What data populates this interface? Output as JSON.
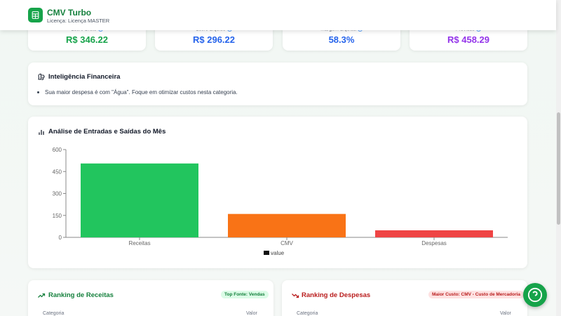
{
  "header": {
    "title": "CMV Turbo",
    "subtitle": "Licença: Licença MASTER"
  },
  "kpis": [
    {
      "label": "Lucro Bruto",
      "value": "R$ 346.22",
      "color": "#16a34a"
    },
    {
      "label": "Lucro Líquido",
      "value": "R$ 296.22",
      "color": "#2563eb"
    },
    {
      "label": "Margem Líquida",
      "value": "58.3%",
      "color": "#2563eb"
    },
    {
      "label": "Previsão",
      "value": "R$ 458.29",
      "color": "#9333ea"
    }
  ],
  "insights": {
    "title": "Inteligência Financeira",
    "items": [
      "Sua maior despesa é com \"Água\". Foque em otimizar custos nesta categoria."
    ]
  },
  "chart_section": {
    "title": "Análise de Entradas e Saídas do Mês"
  },
  "chart_data": {
    "type": "bar",
    "categories": [
      "Receitas",
      "CMV",
      "Despesas"
    ],
    "values": [
      505,
      160,
      48
    ],
    "colors": [
      "#22c55e",
      "#f97316",
      "#ef4444"
    ],
    "ylim": [
      0,
      600
    ],
    "yticks": [
      0,
      150,
      300,
      450,
      600
    ],
    "legend": [
      "value"
    ],
    "legend_position": "bottom",
    "grid": false
  },
  "ranking_receitas": {
    "title": "Ranking de Receitas",
    "badge": "Top Fonte: Vendas",
    "col_categoria": "Categoria",
    "col_valor": "Valor"
  },
  "ranking_despesas": {
    "title": "Ranking de Despesas",
    "badge": "Maior Custo: CMV - Custo de Mercadoria",
    "col_categoria": "Categoria",
    "col_valor": "Valor"
  },
  "icons": {
    "logo": "calculator-icon",
    "insight": "brain-icon",
    "chart": "bar-chart-icon",
    "trend_up": "trending-up-icon",
    "trend_down": "trending-down-icon",
    "help": "help-circle-icon"
  }
}
